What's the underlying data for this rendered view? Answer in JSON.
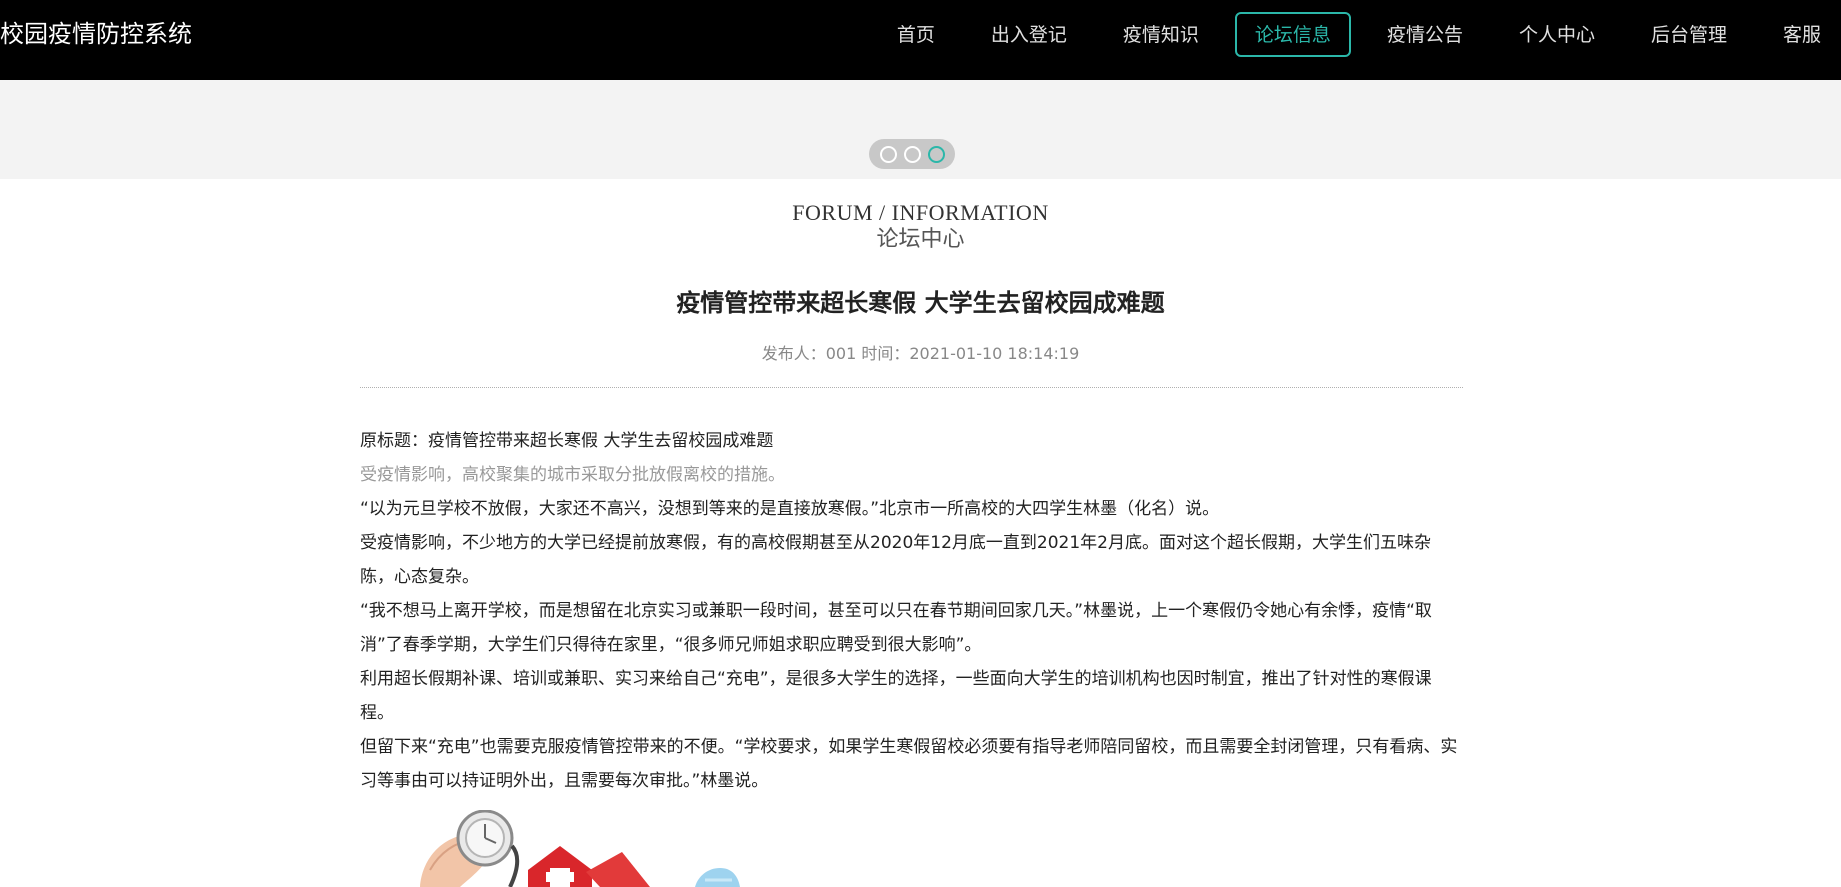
{
  "header": {
    "site_title": "校园疫情防控系统",
    "nav": [
      {
        "label": "首页",
        "active": false
      },
      {
        "label": "出入登记",
        "active": false
      },
      {
        "label": "疫情知识",
        "active": false
      },
      {
        "label": "论坛信息",
        "active": true
      },
      {
        "label": "疫情公告",
        "active": false
      },
      {
        "label": "个人中心",
        "active": false
      },
      {
        "label": "后台管理",
        "active": false
      },
      {
        "label": "客服",
        "active": false
      }
    ],
    "accent_color": "#2bb7a9"
  },
  "carousel": {
    "slide_count": 3,
    "active_index": 2
  },
  "section": {
    "title_en": "FORUM / INFORMATION",
    "title_cn": "论坛中心"
  },
  "article": {
    "title": "疫情管控带来超长寒假 大学生去留校园成难题",
    "publisher_label": "发布人：",
    "publisher": "001",
    "time_label": "时间：",
    "time": "2021-01-10 18:14:19",
    "paragraphs": [
      "原标题：疫情管控带来超长寒假 大学生去留校园成难题",
      "受疫情影响，高校聚集的城市采取分批放假离校的措施。",
      "“以为元旦学校不放假，大家还不高兴，没想到等来的是直接放寒假。”北京市一所高校的大四学生林墨（化名）说。",
      "受疫情影响，不少地方的大学已经提前放寒假，有的高校假期甚至从2020年12月底一直到2021年2月底。面对这个超长假期，大学生们五味杂陈，心态复杂。",
      "“我不想马上离开学校，而是想留在北京实习或兼职一段时间，甚至可以只在春节期间回家几天。”林墨说，上一个寒假仍令她心有余悸，疫情“取消”了春季学期，大学生们只得待在家里，“很多师兄师姐求职应聘受到很大影响”。",
      "利用超长假期补课、培训或兼职、实习来给自己“充电”，是很多大学生的选择，一些面向大学生的培训机构也因时制宜，推出了针对性的寒假课程。",
      "但留下来“充电”也需要克服疫情管控带来的不便。“学校要求，如果学生寒假留校必须要有指导老师陪同留校，而且需要全封闭管理，只有看病、实习等事由可以持证明外出，且需要每次审批。”林墨说。"
    ]
  }
}
